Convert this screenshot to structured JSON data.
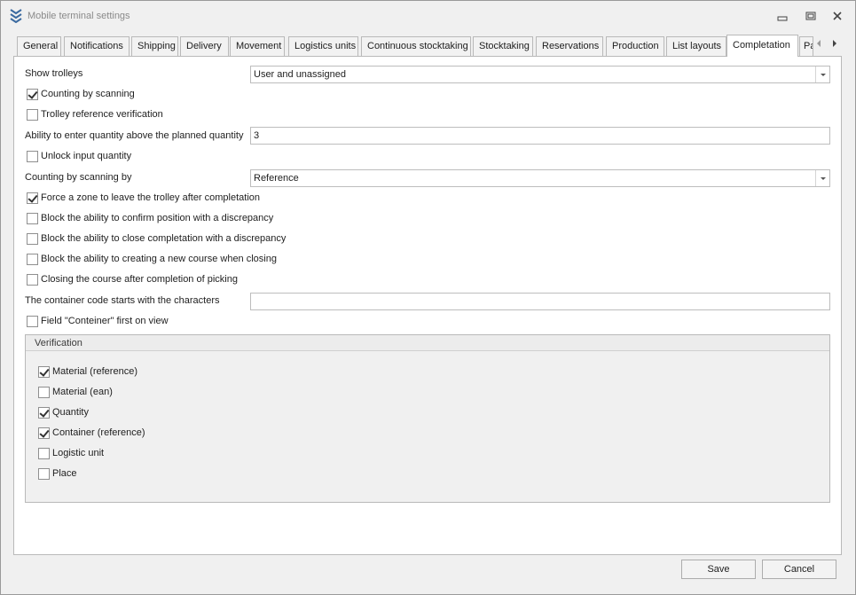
{
  "window": {
    "title": "Mobile terminal settings",
    "icons": {
      "app": "chevrons-down-icon",
      "minimize": "minimize-icon",
      "maximize": "restore-icon",
      "close": "close-icon"
    }
  },
  "tabs": [
    {
      "label": "General",
      "active": false
    },
    {
      "label": "Notifications",
      "active": false
    },
    {
      "label": "Shipping",
      "active": false
    },
    {
      "label": "Delivery",
      "active": false
    },
    {
      "label": "Movement",
      "active": false
    },
    {
      "label": "Logistics units",
      "active": false
    },
    {
      "label": "Continuous stocktaking",
      "active": false
    },
    {
      "label": "Stocktaking",
      "active": false
    },
    {
      "label": "Reservations",
      "active": false
    },
    {
      "label": "Production",
      "active": false
    },
    {
      "label": "List layouts",
      "active": false
    },
    {
      "label": "Completation",
      "active": true
    },
    {
      "label": "Pa",
      "active": false
    }
  ],
  "form": {
    "show_trolleys": {
      "label": "Show trolleys",
      "value": "User and unassigned"
    },
    "counting_by_scanning": {
      "label": "Counting by scanning",
      "checked": true
    },
    "trolley_reference_verification": {
      "label": "Trolley reference verification",
      "checked": false
    },
    "quantity_above_planned": {
      "label": "Ability to enter quantity above the planned quantity",
      "value": "3"
    },
    "unlock_input_quantity": {
      "label": "Unlock input quantity",
      "checked": false
    },
    "counting_by_scanning_by": {
      "label": "Counting by scanning by",
      "value": "Reference"
    },
    "force_zone": {
      "label": "Force a zone to leave the trolley after completation",
      "checked": true
    },
    "block_confirm_position": {
      "label": "Block the ability to confirm position with a discrepancy",
      "checked": false
    },
    "block_close_completation": {
      "label": "Block the ability to close completation with a discrepancy",
      "checked": false
    },
    "block_new_course": {
      "label": "Block the ability to creating a new course when closing",
      "checked": false
    },
    "closing_course": {
      "label": "Closing the course after completion of picking",
      "checked": false
    },
    "container_code_start": {
      "label": "The container code starts with the characters",
      "value": ""
    },
    "field_container_first": {
      "label": "Field \"Conteiner\" first on view",
      "checked": false
    }
  },
  "verification": {
    "title": "Verification",
    "items": [
      {
        "label": "Material (reference)",
        "checked": true
      },
      {
        "label": "Material (ean)",
        "checked": false
      },
      {
        "label": "Quantity",
        "checked": true
      },
      {
        "label": "Container (reference)",
        "checked": true
      },
      {
        "label": "Logistic unit",
        "checked": false
      },
      {
        "label": "Place",
        "checked": false
      }
    ]
  },
  "buttons": {
    "save": "Save",
    "cancel": "Cancel"
  }
}
